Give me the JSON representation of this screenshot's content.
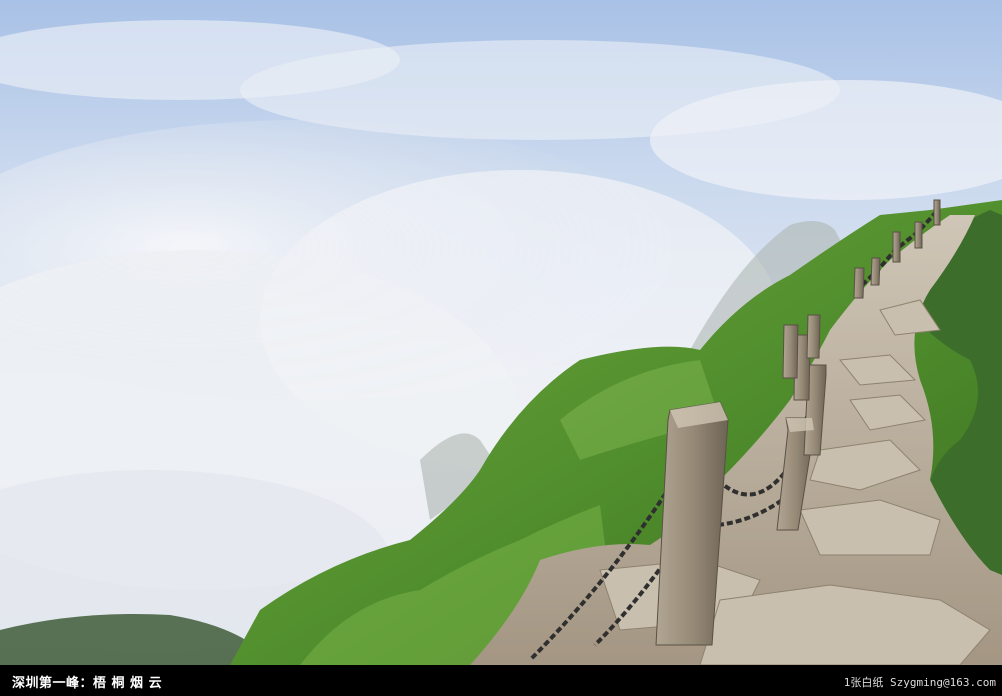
{
  "caption": {
    "title": "深圳第一峰：梧 桐 烟 云",
    "credit": "1张白纸 Szygming@163.com"
  },
  "scene": {
    "description_colors": {
      "sky_top": "#a9c3e8",
      "cloud": "#eef1f6",
      "grass": "#5f9a35",
      "rock": "#b9ad9c",
      "post": "#9c917f",
      "chain": "#3a3a3a"
    }
  }
}
